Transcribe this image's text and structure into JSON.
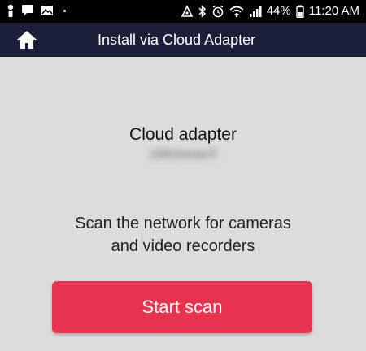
{
  "status_bar": {
    "battery": "44%",
    "time": "11:20 AM",
    "left_icons": [
      "person-icon",
      "message-icon",
      "gallery-icon"
    ],
    "right_icons": [
      "network-icon",
      "bluetooth-icon",
      "alarm-icon",
      "wifi-icon",
      "signal-icon",
      "battery-icon"
    ]
  },
  "app_bar": {
    "title": "Install via Cloud Adapter",
    "home_icon": "home-icon"
  },
  "main": {
    "device_name": "Cloud adapter",
    "device_id": "1f4h3m4a7l",
    "description_line1": "Scan the network for cameras",
    "description_line2": "and video recorders",
    "start_button": "Start scan"
  },
  "colors": {
    "status_bar_bg": "#000000",
    "app_bar_bg": "#1b1f3a",
    "background": "#dcdcdc",
    "button": "#e8334f"
  }
}
